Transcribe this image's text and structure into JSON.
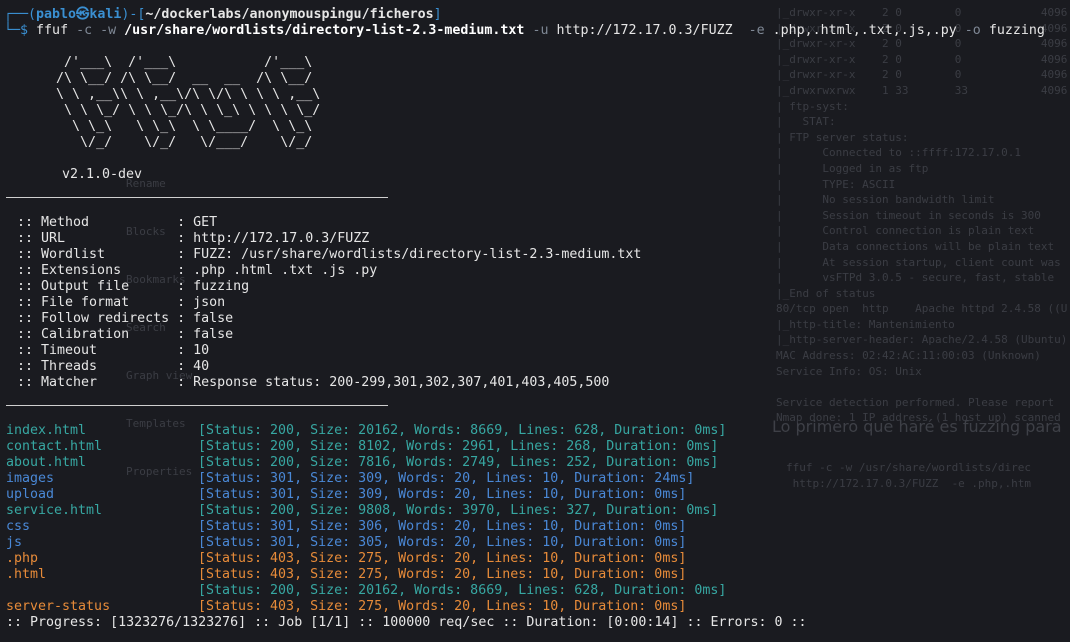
{
  "prompt": {
    "box_top": "┌──(",
    "user": "pablo㉿kali",
    "mid": ")-[",
    "path": "~/dockerlabs/anonymouspingu/ficheros",
    "end": "]",
    "box_bottom": "└─$",
    "command": {
      "prog": "ffuf",
      "f1": "-c -w",
      "wordlist": "/usr/share/wordlists/directory-list-2.3-medium.txt",
      "f2": "-u",
      "url": "http://172.17.0.3/FUZZ",
      "f3": "-e",
      "ext": ".php,.html,.txt,.js,.py",
      "f4": "-o",
      "out": "fuzzing"
    }
  },
  "banner": [
    "        /'___\\  /'___\\           /'___\\       ",
    "       /\\ \\__/ /\\ \\__/  __  __  /\\ \\__/       ",
    "       \\ \\ ,__\\\\ \\ ,__\\/\\ \\/\\ \\ \\ \\ ,__\\      ",
    "        \\ \\ \\_/ \\ \\ \\_/\\ \\ \\_\\ \\ \\ \\ \\_/      ",
    "         \\ \\_\\   \\ \\_\\  \\ \\____/  \\ \\_\\       ",
    "          \\/_/    \\/_/   \\/___/    \\/_/       "
  ],
  "version": "v2.1.0-dev",
  "config": [
    " :: Method           : GET",
    " :: URL              : http://172.17.0.3/FUZZ",
    " :: Wordlist         : FUZZ: /usr/share/wordlists/directory-list-2.3-medium.txt",
    " :: Extensions       : .php .html .txt .js .py",
    " :: Output file      : fuzzing",
    " :: File format      : json",
    " :: Follow redirects : false",
    " :: Calibration      : false",
    " :: Timeout          : 10",
    " :: Threads          : 40",
    " :: Matcher          : Response status: 200-299,301,302,307,401,403,405,500"
  ],
  "results": [
    {
      "name": "index.html",
      "status": "[Status: 200, Size: 20162, Words: 8669, Lines: 628, Duration: 0ms]",
      "color": "teal"
    },
    {
      "name": "contact.html",
      "status": "[Status: 200, Size: 8102, Words: 2961, Lines: 268, Duration: 0ms]",
      "color": "teal"
    },
    {
      "name": "about.html",
      "status": "[Status: 200, Size: 7816, Words: 2749, Lines: 252, Duration: 0ms]",
      "color": "teal"
    },
    {
      "name": "images",
      "status": "[Status: 301, Size: 309, Words: 20, Lines: 10, Duration: 24ms]",
      "color": "blue"
    },
    {
      "name": "upload",
      "status": "[Status: 301, Size: 309, Words: 20, Lines: 10, Duration: 0ms]",
      "color": "blue"
    },
    {
      "name": "service.html",
      "status": "[Status: 200, Size: 9808, Words: 3970, Lines: 327, Duration: 0ms]",
      "color": "teal"
    },
    {
      "name": "css",
      "status": "[Status: 301, Size: 306, Words: 20, Lines: 10, Duration: 0ms]",
      "color": "blue"
    },
    {
      "name": "js",
      "status": "[Status: 301, Size: 305, Words: 20, Lines: 10, Duration: 0ms]",
      "color": "blue"
    },
    {
      "name": ".php",
      "status": "[Status: 403, Size: 275, Words: 20, Lines: 10, Duration: 0ms]",
      "color": "orange"
    },
    {
      "name": ".html",
      "status": "[Status: 403, Size: 275, Words: 20, Lines: 10, Duration: 0ms]",
      "color": "orange"
    },
    {
      "name": "",
      "status": "[Status: 200, Size: 20162, Words: 8669, Lines: 628, Duration: 0ms]",
      "color": "teal"
    },
    {
      "name": "server-status",
      "status": "[Status: 403, Size: 275, Words: 20, Lines: 10, Duration: 0ms]",
      "color": "orange"
    }
  ],
  "progress": ":: Progress: [1323276/1323276] :: Job [1/1] :: 100000 req/sec :: Duration: [0:00:14] :: Errors: 0 ::",
  "colors": {
    "background": "#1a1b20",
    "status_200": "#37a7a2",
    "status_301": "#4a88d6",
    "status_403": "#e78b39",
    "prompt": "#3a8fd1"
  }
}
